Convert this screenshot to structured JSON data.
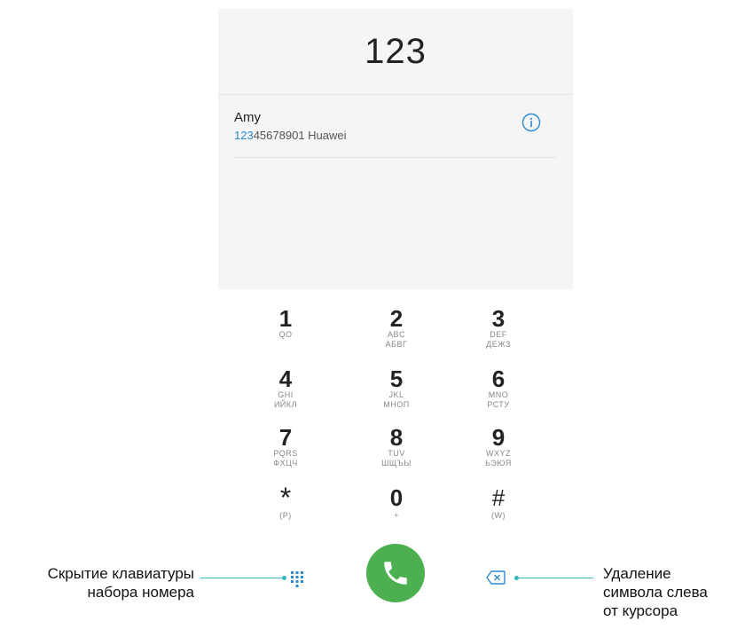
{
  "display": {
    "number": "123"
  },
  "contact": {
    "name": "Amy",
    "number_match": "123",
    "number_rest": "45678901",
    "carrier": " Huawei"
  },
  "keypad": [
    {
      "digit": "1",
      "sub1": "QO",
      "sub2": ""
    },
    {
      "digit": "2",
      "sub1": "ABC",
      "sub2": "АБВГ"
    },
    {
      "digit": "3",
      "sub1": "DEF",
      "sub2": "ДЕЖЗ"
    },
    {
      "digit": "4",
      "sub1": "GHI",
      "sub2": "ИЙКЛ"
    },
    {
      "digit": "5",
      "sub1": "JKL",
      "sub2": "МНОП"
    },
    {
      "digit": "6",
      "sub1": "MNO",
      "sub2": "РСТУ"
    },
    {
      "digit": "7",
      "sub1": "PQRS",
      "sub2": "ФХЦЧ"
    },
    {
      "digit": "8",
      "sub1": "TUV",
      "sub2": "ШЩЪЫ"
    },
    {
      "digit": "9",
      "sub1": "WXYZ",
      "sub2": "ЬЭЮЯ"
    },
    {
      "digit": "*",
      "sub1": "(P)",
      "sub2": ""
    },
    {
      "digit": "0",
      "sub1": "+",
      "sub2": ""
    },
    {
      "digit": "#",
      "sub1": "(W)",
      "sub2": ""
    }
  ],
  "callouts": {
    "left_line1": "Скрытие клавиатуры",
    "left_line2": "набора номера",
    "right_line1": "Удаление",
    "right_line2": "символа слева",
    "right_line3": "от курсора"
  },
  "icons": {
    "info": "info-icon",
    "dialpad": "dialpad-grid-icon",
    "call": "phone-icon",
    "delete": "backspace-icon"
  },
  "colors": {
    "accent": "#2a8ad4",
    "call_green": "#4caf50",
    "callout": "#33b7c0"
  }
}
